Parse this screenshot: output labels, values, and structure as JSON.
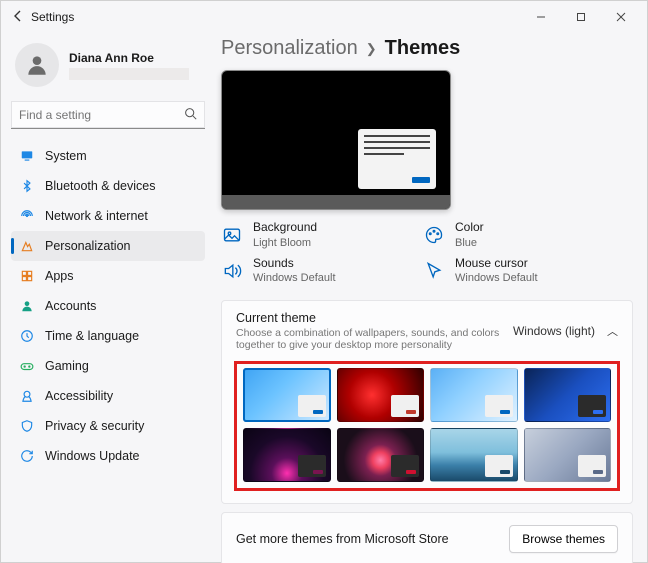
{
  "window": {
    "title": "Settings"
  },
  "user": {
    "name": "Diana Ann Roe"
  },
  "search": {
    "placeholder": "Find a setting"
  },
  "nav": [
    {
      "label": "System",
      "color": "#1e88e5"
    },
    {
      "label": "Bluetooth & devices",
      "color": "#1e88e5"
    },
    {
      "label": "Network & internet",
      "color": "#1e88e5"
    },
    {
      "label": "Personalization",
      "color": "#0067c0",
      "selected": true
    },
    {
      "label": "Apps",
      "color": "#e67e22"
    },
    {
      "label": "Accounts",
      "color": "#16a085"
    },
    {
      "label": "Time & language",
      "color": "#1e88e5"
    },
    {
      "label": "Gaming",
      "color": "#27ae60"
    },
    {
      "label": "Accessibility",
      "color": "#1e88e5"
    },
    {
      "label": "Privacy & security",
      "color": "#1e88e5"
    },
    {
      "label": "Windows Update",
      "color": "#1e88e5"
    }
  ],
  "breadcrumb": {
    "parent": "Personalization",
    "current": "Themes"
  },
  "props": {
    "background": {
      "label": "Background",
      "value": "Light Bloom"
    },
    "color": {
      "label": "Color",
      "value": "Blue"
    },
    "sounds": {
      "label": "Sounds",
      "value": "Windows Default"
    },
    "cursor": {
      "label": "Mouse cursor",
      "value": "Windows Default"
    }
  },
  "currentTheme": {
    "title": "Current theme",
    "subtitle": "Choose a combination of wallpapers, sounds, and colors together to give your desktop more personality",
    "value": "Windows (light)"
  },
  "themes": [
    {
      "bg": "linear-gradient(135deg,#3fa4f4 0%,#6cc3ff 40%,#cfe9ff 100%)",
      "card": "light",
      "btn": "#0067c0",
      "selected": true
    },
    {
      "bg": "radial-gradient(circle at 40% 50%, #ff3030 0%, #b00000 40%, #300000 100%)",
      "card": "light",
      "btn": "#c0392b"
    },
    {
      "bg": "linear-gradient(135deg,#5bb0f5 0%,#8fd0ff 40%,#dff1ff 100%)",
      "card": "light",
      "btn": "#0067c0"
    },
    {
      "bg": "linear-gradient(135deg,#0a2458 0%,#1a4fbf 50%,#2d6ef0 100%)",
      "card": "dark",
      "btn": "#2d6ef0"
    },
    {
      "bg": "radial-gradient(circle at 50% 85%, #ff2fb0 0%, #5a0f5a 25%, #1a0828 60%, #0a0414 100%)",
      "card": "dark",
      "btn": "#7a1450"
    },
    {
      "bg": "radial-gradient(circle at 50% 60%, #ff7da8 0%, #ef4060 15%, #7a2050 30%, #1a0e1a 70%)",
      "card": "dark",
      "btn": "#d01030"
    },
    {
      "bg": "linear-gradient(180deg,#a8d5e8 0%,#7fbfdc 45%,#3a7fa8 70%,#1a4a6a 100%)",
      "card": "light",
      "btn": "#1a4a6a"
    },
    {
      "bg": "linear-gradient(135deg,#c7cfdc 0%,#9aa8c1 50%,#6a7a98 100%)",
      "card": "light",
      "btn": "#5a6a88"
    }
  ],
  "store": {
    "text": "Get more themes from Microsoft Store",
    "button": "Browse themes"
  },
  "accent": "#0067c0"
}
